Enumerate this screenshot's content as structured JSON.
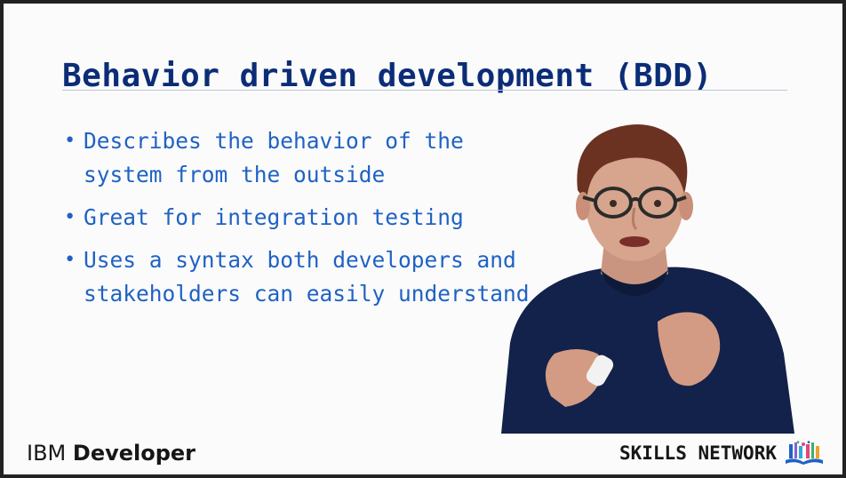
{
  "slide": {
    "title": "Behavior driven development (BDD)",
    "bullets": [
      "Describes the behavior of the system from the outside",
      "Great for integration testing",
      "Uses a syntax both developers and stakeholders can easily understand"
    ],
    "bullet_symbol": "•"
  },
  "branding": {
    "ibm_light": "IBM",
    "ibm_bold": "Developer",
    "skills_network": "SKILLS NETWORK",
    "skills_logo_icon": "skills-network-books-icon"
  },
  "colors": {
    "title": "#0b2d77",
    "bullets": "#1f62c4",
    "sweater": "#13224a",
    "hair": "#6b3222"
  }
}
